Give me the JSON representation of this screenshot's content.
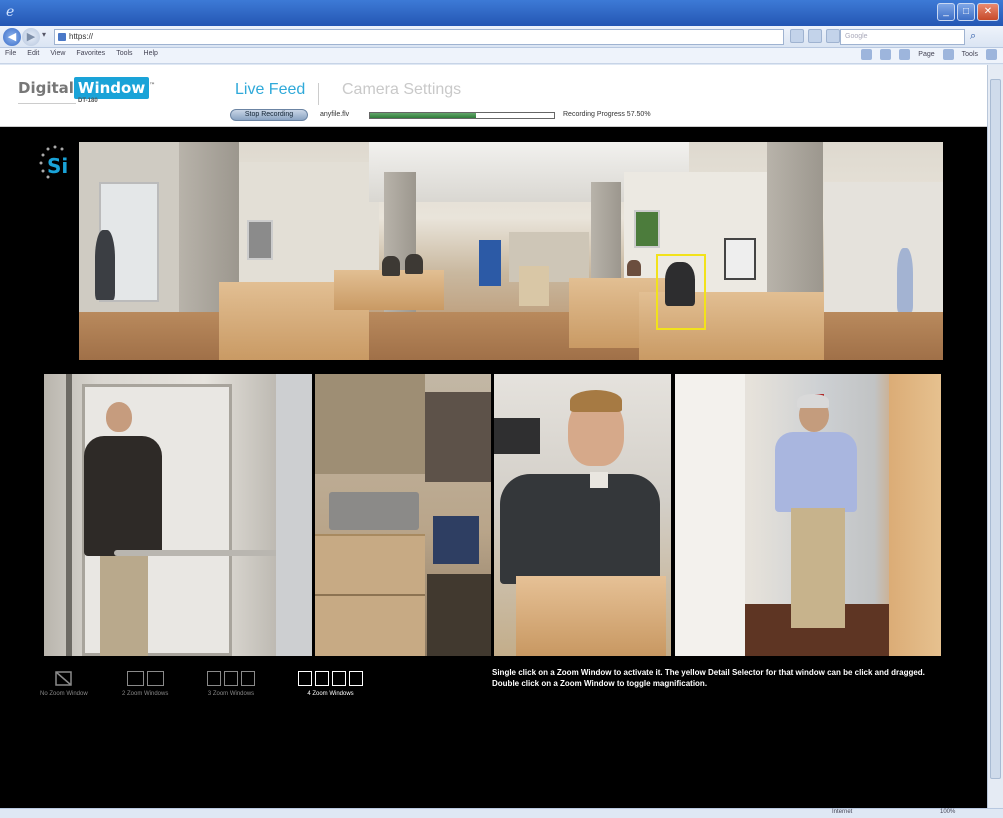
{
  "browser": {
    "url": "https://",
    "search_placeholder": "Google",
    "menu": [
      "File",
      "Edit",
      "View",
      "Favorites",
      "Tools",
      "Help"
    ],
    "commands": [
      "Page",
      "Tools"
    ],
    "status_zone": "Internet",
    "status_zoom": "100%"
  },
  "app": {
    "logo": {
      "brand_part1": "Digital",
      "brand_part2": "Window",
      "trademark": "™",
      "model": "DT-180"
    },
    "tabs": [
      {
        "label": "Live Feed",
        "active": true
      },
      {
        "label": "Camera Settings",
        "active": false
      }
    ],
    "recording": {
      "button_label": "Stop Recording",
      "filename": "anyfile.flv",
      "progress_text": "Recording Progress 57.50%",
      "progress_fraction": 0.575
    },
    "badge": "Si"
  },
  "zoom_layouts": [
    {
      "label": "No Zoom Window",
      "count": 0,
      "active": false
    },
    {
      "label": "2 Zoom Windows",
      "count": 2,
      "active": false
    },
    {
      "label": "3 Zoom Windows",
      "count": 3,
      "active": false
    },
    {
      "label": "4 Zoom Windows",
      "count": 4,
      "active": true
    }
  ],
  "instructions": {
    "line1": "Single click on a Zoom Window to activate it. The yellow Detail Selector for that window can be click and dragged.",
    "line2": "Double click on a Zoom Window to toggle magnification."
  },
  "colors": {
    "tab_active": "#2fa9d9",
    "tab_inactive": "#c9c9c9",
    "detail_selector": "#f2e21b",
    "progress_fill": "#2f7c39",
    "page_background": "#000000"
  }
}
